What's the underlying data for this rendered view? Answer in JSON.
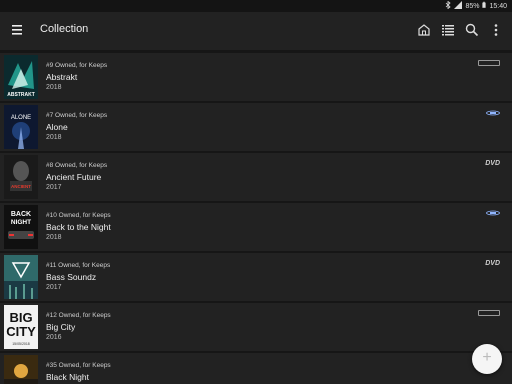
{
  "status": {
    "battery_percent": "85%",
    "time": "15:40"
  },
  "appbar": {
    "title": "Collection",
    "icons": [
      "menu-icon",
      "home-icon",
      "list-view-icon",
      "search-icon",
      "more-vert-icon"
    ]
  },
  "items": [
    {
      "owned": "#9 Owned, for Keeps",
      "title": "Abstrakt",
      "year": "2018",
      "format": "hd-dvd-icon"
    },
    {
      "owned": "#7 Owned, for Keeps",
      "title": "Alone",
      "year": "2018",
      "format": "blu-ray-icon"
    },
    {
      "owned": "#8 Owned, for Keeps",
      "title": "Ancient Future",
      "year": "2017",
      "format": "dvd-icon",
      "format_text": "DVD"
    },
    {
      "owned": "#10 Owned, for Keeps",
      "title": "Back to the Night",
      "year": "2018",
      "format": "blu-ray-icon"
    },
    {
      "owned": "#11 Owned, for Keeps",
      "title": "Bass Soundz",
      "year": "2017",
      "format": "dvd-icon",
      "format_text": "DVD"
    },
    {
      "owned": "#12 Owned, for Keeps",
      "title": "Big City",
      "year": "2016",
      "format": "hd-dvd-icon"
    },
    {
      "owned": "#35 Owned, for Keeps",
      "title": "Black Night",
      "year": "2017",
      "format": ""
    }
  ],
  "covers": {
    "abstrakt": "ABSTRAKT",
    "alone": "ALONE",
    "ancient": "ANCIENT",
    "back_line1": "BACK",
    "back_line2": "NIGHT",
    "big_line1": "BIG",
    "big_line2": "CITY",
    "big_date": "15/05/2018"
  },
  "fab": {
    "symbol": "+"
  },
  "colors": {
    "background": "#161616",
    "row": "#222222",
    "appbar": "#222222",
    "fab": "#f5f5f5"
  }
}
